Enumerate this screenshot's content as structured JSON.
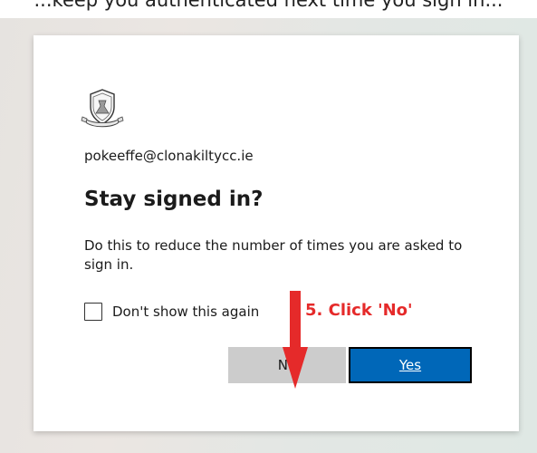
{
  "header": {
    "fragment_text": "...keep you authenticated  next time you sign in..."
  },
  "account": {
    "email": "pokeeffe@clonakiltycc.ie"
  },
  "prompt": {
    "title": "Stay signed in?",
    "description": "Do this to reduce the number of times you are asked to sign in.",
    "checkbox_label": "Don't show this again",
    "checkbox_checked": false
  },
  "buttons": {
    "no_label": "No",
    "yes_label": "Yes"
  },
  "annotation": {
    "text": "5. Click 'No'",
    "color": "#e52a2a"
  },
  "colors": {
    "primary": "#0067b8",
    "secondary_button": "#cccccc",
    "accent_annotation": "#e52a2a"
  },
  "icons": {
    "logo": "school-crest-icon",
    "arrow": "red-down-arrow-icon"
  }
}
